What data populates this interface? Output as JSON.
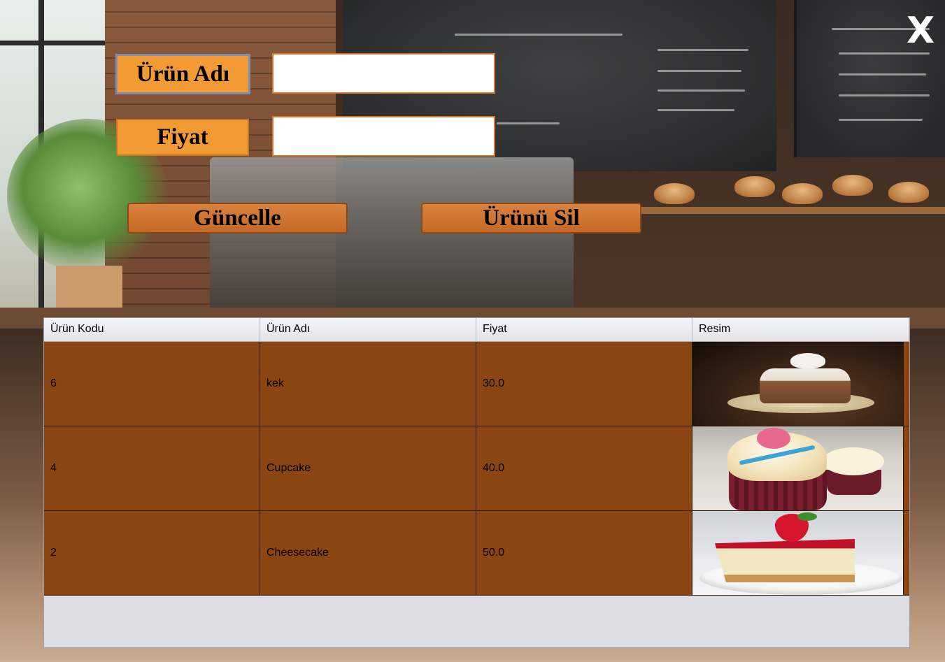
{
  "window": {
    "close_label": "X"
  },
  "form": {
    "name_label": "Ürün Adı",
    "name_value": "",
    "price_label": "Fiyat",
    "price_value": ""
  },
  "buttons": {
    "update": "Güncelle",
    "delete": "Ürünü Sil"
  },
  "table": {
    "headers": [
      "Ürün Kodu",
      "Ürün Adı",
      "Fiyat",
      "Resim"
    ],
    "rows": [
      {
        "code": "6",
        "name": "kek",
        "price": "30.0",
        "image": "cake-image"
      },
      {
        "code": "4",
        "name": "Cupcake",
        "price": "40.0",
        "image": "cupcake-image"
      },
      {
        "code": "2",
        "name": "Cheesecake",
        "price": "50.0",
        "image": "cheesecake-image"
      }
    ]
  },
  "colors": {
    "label_bg": "#f29a34",
    "button_bg": "#c46a26",
    "row_bg": "#8b4513",
    "table_empty_bg": "#dcdde2"
  }
}
